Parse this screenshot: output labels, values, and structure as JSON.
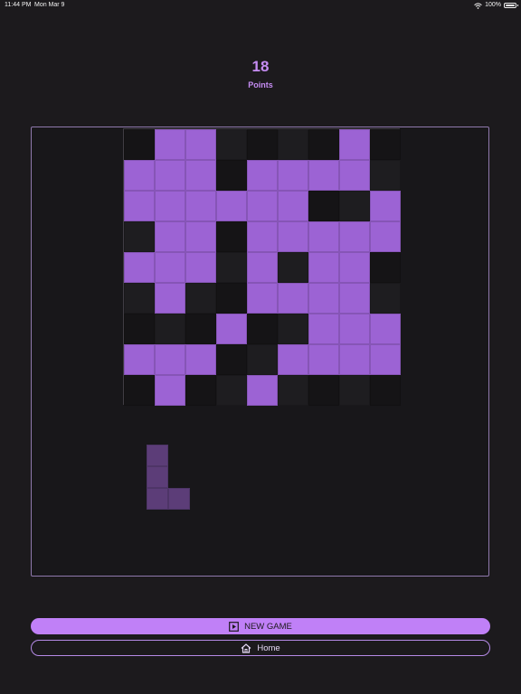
{
  "status_bar": {
    "time": "11:44 PM",
    "date": "Mon Mar 9",
    "battery": "100%"
  },
  "score": {
    "value": "18",
    "label": "Points"
  },
  "board": {
    "rows": 9,
    "cols": 9,
    "cells": [
      [
        0,
        1,
        1,
        0,
        0,
        0,
        0,
        1,
        0
      ],
      [
        1,
        1,
        1,
        0,
        1,
        1,
        1,
        1,
        0
      ],
      [
        1,
        1,
        1,
        1,
        1,
        1,
        0,
        0,
        1
      ],
      [
        0,
        1,
        1,
        0,
        1,
        1,
        1,
        1,
        1
      ],
      [
        1,
        1,
        1,
        0,
        1,
        0,
        1,
        1,
        0
      ],
      [
        0,
        1,
        0,
        0,
        1,
        1,
        1,
        1,
        0
      ],
      [
        0,
        0,
        0,
        1,
        0,
        0,
        1,
        1,
        1
      ],
      [
        1,
        1,
        1,
        0,
        0,
        1,
        1,
        1,
        1
      ],
      [
        0,
        1,
        0,
        0,
        1,
        0,
        0,
        0,
        0
      ]
    ]
  },
  "next_piece": {
    "shape": "L",
    "cells": [
      [
        0,
        0
      ],
      [
        1,
        0
      ],
      [
        2,
        0
      ],
      [
        2,
        1
      ]
    ]
  },
  "buttons": {
    "new_game": "NEW GAME",
    "home": "Home"
  },
  "colors": {
    "accent": "#c080f7",
    "tile_filled": "#9c63d4",
    "piece": "#5c3d78",
    "background": "#1c1a1d"
  }
}
